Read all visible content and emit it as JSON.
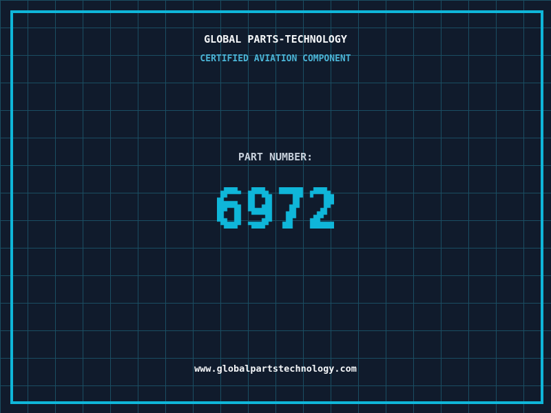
{
  "header": {
    "title": "GLOBAL PARTS-TECHNOLOGY",
    "subtitle": "CERTIFIED AVIATION COMPONENT"
  },
  "part": {
    "label": "PART NUMBER:",
    "number": "6972"
  },
  "footer": {
    "website": "www.globalpartstechnology.com"
  },
  "colors": {
    "background": "#101b2c",
    "grid": "#1a4e63",
    "accent": "#0fb6d9",
    "subtitle": "#4bb4d6",
    "label": "#c7d0db",
    "text": "#f4f6f8"
  }
}
